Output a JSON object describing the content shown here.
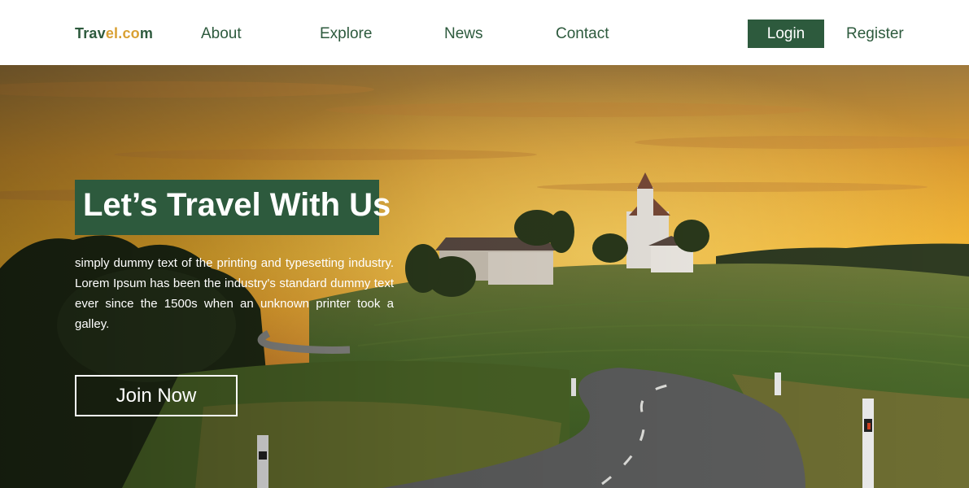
{
  "nav": {
    "logo_part1": "Trav",
    "logo_part2": "el.co",
    "logo_part3": "m",
    "links": [
      "About",
      "Explore",
      "News",
      "Contact"
    ],
    "login_label": "Login",
    "register_label": "Register"
  },
  "hero": {
    "headline": "Let’s Travel With Us",
    "body": "simply dummy text of the printing and typesetting industry. Lorem Ipsum has been the industry's standard dummy text ever since the 1500s when an unknown printer took a galley.",
    "cta_label": "Join Now"
  },
  "colors": {
    "brand_green": "#2d5a3d",
    "logo_accent": "#d9a033",
    "sky_gold": "#f0a828"
  },
  "icons": [
    "landscape-photo"
  ]
}
